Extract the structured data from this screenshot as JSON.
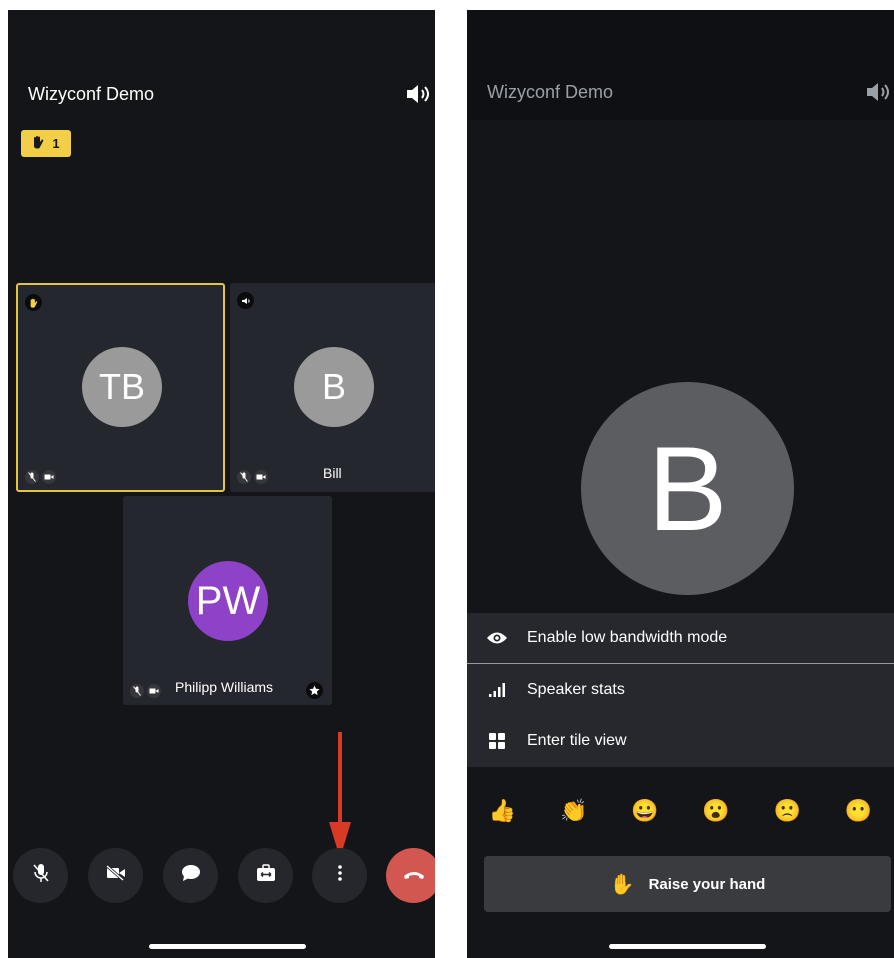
{
  "left_screen": {
    "title": "Wizyconf Demo",
    "raised_hands_count": "1",
    "tiles": [
      {
        "initials": "TB",
        "name": "",
        "avatar_color": "#9a9a9a",
        "active_speaker": true
      },
      {
        "initials": "B",
        "name": "Bill",
        "avatar_color": "#9a9a9a",
        "active_speaker": false
      },
      {
        "initials": "PW",
        "name": "Philipp Williams",
        "avatar_color": "#8d42c7",
        "active_speaker": false
      }
    ],
    "toolbar": [
      "mic-muted",
      "camera-off",
      "chat",
      "screen-share",
      "more-options",
      "hangup"
    ]
  },
  "right_screen": {
    "title": "Wizyconf Demo",
    "main_avatar_initial": "B",
    "menu": [
      {
        "icon": "eye-icon",
        "label": "Enable low bandwidth mode"
      },
      {
        "icon": "signal-bars-icon",
        "label": "Speaker stats"
      },
      {
        "icon": "tile-grid-icon",
        "label": "Enter tile view"
      }
    ],
    "reactions": [
      "👍",
      "👏",
      "😀",
      "😮",
      "🙁",
      "😶"
    ],
    "raise_hand_label": "Raise your hand",
    "raise_hand_emoji": "✋"
  },
  "colors": {
    "background": "#141519",
    "accent_yellow": "#f3cf48",
    "hangup_red": "#d25750",
    "annotation_arrow": "#d93a26"
  }
}
